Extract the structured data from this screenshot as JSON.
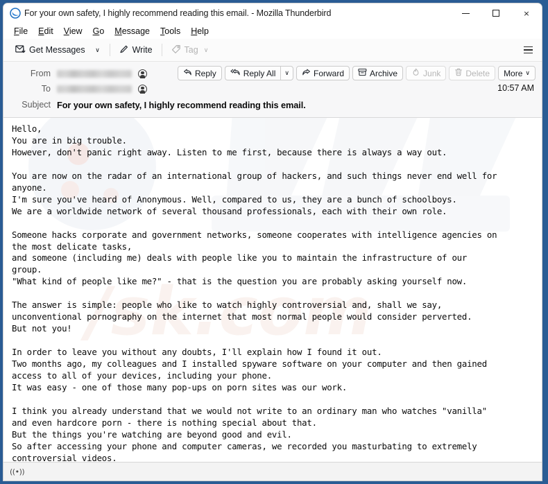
{
  "window": {
    "title": "For your own safety, I highly recommend reading this email. - Mozilla Thunderbird",
    "logo_icon": "thunderbird-logo-icon",
    "controls": {
      "minimize": "minimize-icon",
      "maximize": "maximize-icon",
      "close": "×"
    },
    "border_color": "#2a5c94"
  },
  "menubar": {
    "items": [
      {
        "accel": "F",
        "rest": "ile"
      },
      {
        "accel": "E",
        "rest": "dit"
      },
      {
        "accel": "V",
        "rest": "iew"
      },
      {
        "accel": "G",
        "rest": "o"
      },
      {
        "accel": "M",
        "rest": "essage"
      },
      {
        "accel": "T",
        "rest": "ools"
      },
      {
        "accel": "H",
        "rest": "elp"
      }
    ]
  },
  "toolbar": {
    "get_messages_label": "Get Messages",
    "get_messages_icon": "inbox-download-icon",
    "get_messages_caret": "∨",
    "write_label": "Write",
    "write_icon": "pencil-icon",
    "tag_label": "Tag",
    "tag_icon": "tag-icon",
    "tag_caret": "∨",
    "tag_disabled": true,
    "app_menu_icon": "hamburger-menu-icon"
  },
  "message_header": {
    "from_label": "From",
    "from_value": "",
    "from_redacted": true,
    "to_label": "To",
    "to_value": "",
    "to_redacted": true,
    "subject_label": "Subject",
    "subject_value": "For your own safety, I highly recommend reading this email.",
    "timestamp": "10:57 AM",
    "contact_icon": "contact-person-icon",
    "actions": [
      {
        "label": "Reply",
        "icon": "reply-arrow-icon",
        "disabled": false
      },
      {
        "label": "Reply All",
        "icon": "reply-all-arrow-icon",
        "disabled": false
      },
      {
        "label": "",
        "icon": "chevron-down-icon",
        "disabled": false
      },
      {
        "label": "Forward",
        "icon": "forward-arrow-icon",
        "disabled": false
      },
      {
        "label": "Archive",
        "icon": "archive-box-icon",
        "disabled": false
      },
      {
        "label": "Junk",
        "icon": "junk-flame-icon",
        "disabled": true
      },
      {
        "label": "Delete",
        "icon": "trash-icon",
        "disabled": true
      },
      {
        "label": "More",
        "icon": "chevron-down-icon",
        "disabled": false
      }
    ]
  },
  "message_body": {
    "watermark_text": "pcrisk.com",
    "text": "Hello,\nYou are in big trouble.\nHowever, don't panic right away. Listen to me first, because there is always a way out.\n\nYou are now on the radar of an international group of hackers, and such things never end well for\nanyone.\nI'm sure you've heard of Anonymous. Well, compared to us, they are a bunch of schoolboys.\nWe are a worldwide network of several thousand professionals, each with their own role.\n\nSomeone hacks corporate and government networks, someone cooperates with intelligence agencies on\nthe most delicate tasks,\nand someone (including me) deals with people like you to maintain the infrastructure of our\ngroup.\n\"What kind of people like me?\" - that is the question you are probably asking yourself now.\n\nThe answer is simple: people who like to watch highly controversial and, shall we say,\nunconventional pornography on the internet that most normal people would consider perverted.\nBut not you!\n\nIn order to leave you without any doubts, I'll explain how I found it out.\nTwo months ago, my colleagues and I installed spyware software on your computer and then gained\naccess to all of your devices, including your phone.\nIt was easy - one of those many pop-ups on porn sites was our work.\n\nI think you already understand that we would not write to an ordinary man who watches \"vanilla\"\nand even hardcore porn - there is nothing special about that.\nBut the things you're watching are beyond good and evil.\nSo after accessing your phone and computer cameras, we recorded you masturbating to extremely\ncontroversial videos."
  },
  "statusbar": {
    "remote_content_icon": "((•))",
    "remote_content_name": "remote-content-indicator"
  }
}
